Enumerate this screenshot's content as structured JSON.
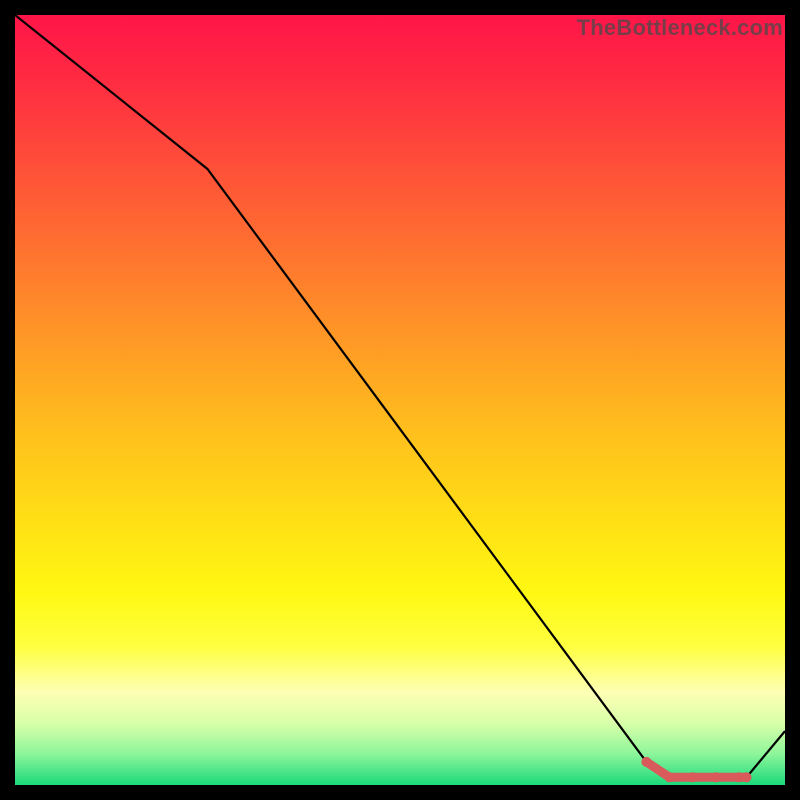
{
  "watermark": "TheBottleneck.com",
  "chart_data": {
    "type": "line",
    "title": "",
    "xlabel": "",
    "ylabel": "",
    "xlim": [
      0,
      100
    ],
    "ylim": [
      0,
      100
    ],
    "series": [
      {
        "name": "bottleneck-curve",
        "x": [
          0,
          25,
          82,
          85,
          95,
          100
        ],
        "values": [
          100,
          80,
          3,
          1,
          1,
          7
        ]
      }
    ],
    "marker": {
      "name": "highlight-segment",
      "x": [
        82,
        85,
        88,
        91,
        94,
        95
      ],
      "values": [
        3,
        1,
        1,
        1,
        1,
        1
      ]
    },
    "colors": {
      "line": "#000000",
      "marker": "#d85a5a"
    }
  }
}
